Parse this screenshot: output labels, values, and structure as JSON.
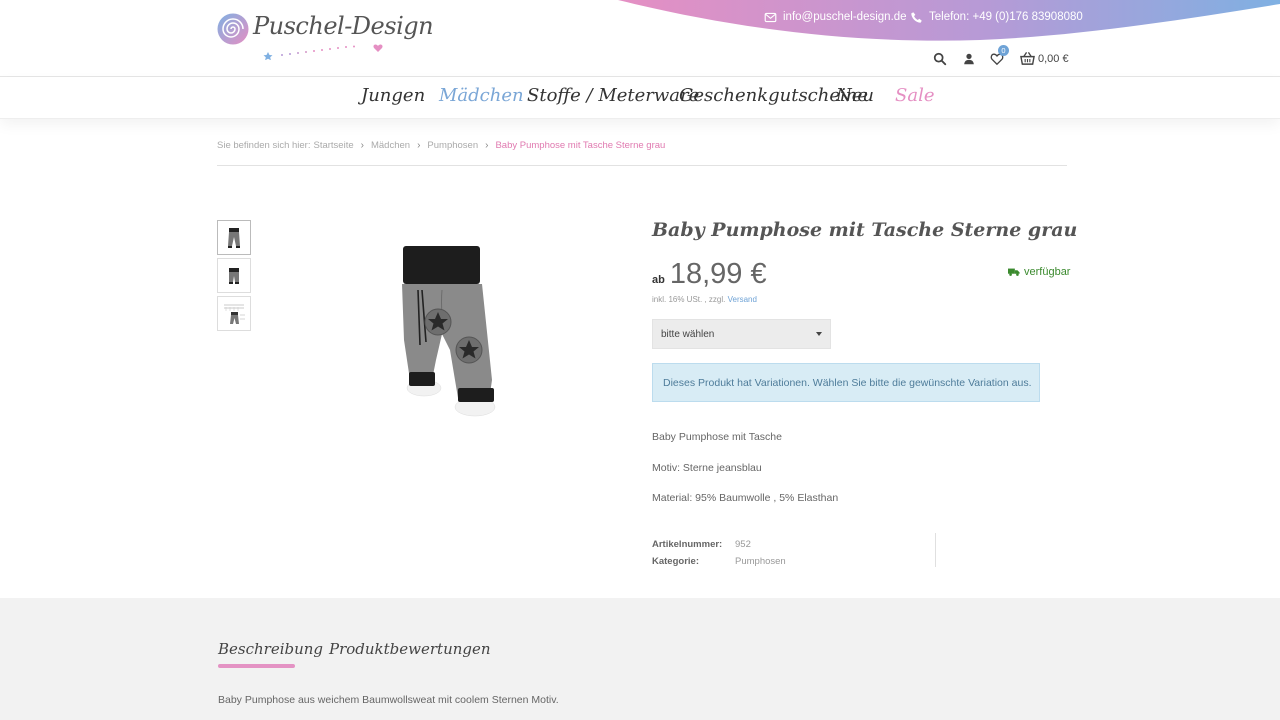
{
  "header": {
    "brand": "Puschel-Design",
    "email": "info@puschel-design.de",
    "phone": "Telefon: +49 (0)176 83908080",
    "wishlist_count": "0",
    "cart_total": "0,00 €",
    "wave_gradient": [
      "#e58fc3",
      "#b79ad6",
      "#7fb0e2"
    ]
  },
  "nav": {
    "items": [
      {
        "label": "Jungen",
        "color": "#333333"
      },
      {
        "label": "Mädchen",
        "color": "#7aa6d6"
      },
      {
        "label": "Stoffe / Meterware",
        "color": "#333333"
      },
      {
        "label": "Geschenkgutscheine",
        "color": "#333333"
      },
      {
        "label": "Neu",
        "color": "#333333"
      },
      {
        "label": "Sale",
        "color": "#e58fc3"
      }
    ]
  },
  "breadcrumb": {
    "prefix": "Sie befinden sich hier:",
    "items": [
      "Startseite",
      "Mädchen",
      "Pumphosen"
    ],
    "current": "Baby Pumphose mit Tasche Sterne grau"
  },
  "product": {
    "title": "Baby Pumphose mit Tasche Sterne grau",
    "price_prefix": "ab",
    "price": "18,99 €",
    "tax_note": "inkl. 16% USt. , zzgl.",
    "shipping_link": "Versand",
    "availability": "verfügbar",
    "select_value": "bitte wählen",
    "variation_notice": "Dieses Produkt hat Variationen. Wählen Sie bitte die gewünschte Variation aus.",
    "description": [
      "Baby Pumphose mit Tasche",
      "Motiv: Sterne jeansblau",
      "Material: 95% Baumwolle , 5% Elasthan"
    ],
    "meta": [
      {
        "label": "Artikelnummer:",
        "value": "952"
      },
      {
        "label": "Kategorie:",
        "value": "Pumphosen"
      }
    ],
    "accent_color": "#e07ab0",
    "stock_color": "#3b8a2e"
  },
  "tabs": {
    "items": [
      "Beschreibung",
      "Produktbewertungen"
    ],
    "active": 0,
    "content": "Baby Pumphose aus weichem Baumwollsweat mit coolem Sternen Motiv."
  }
}
